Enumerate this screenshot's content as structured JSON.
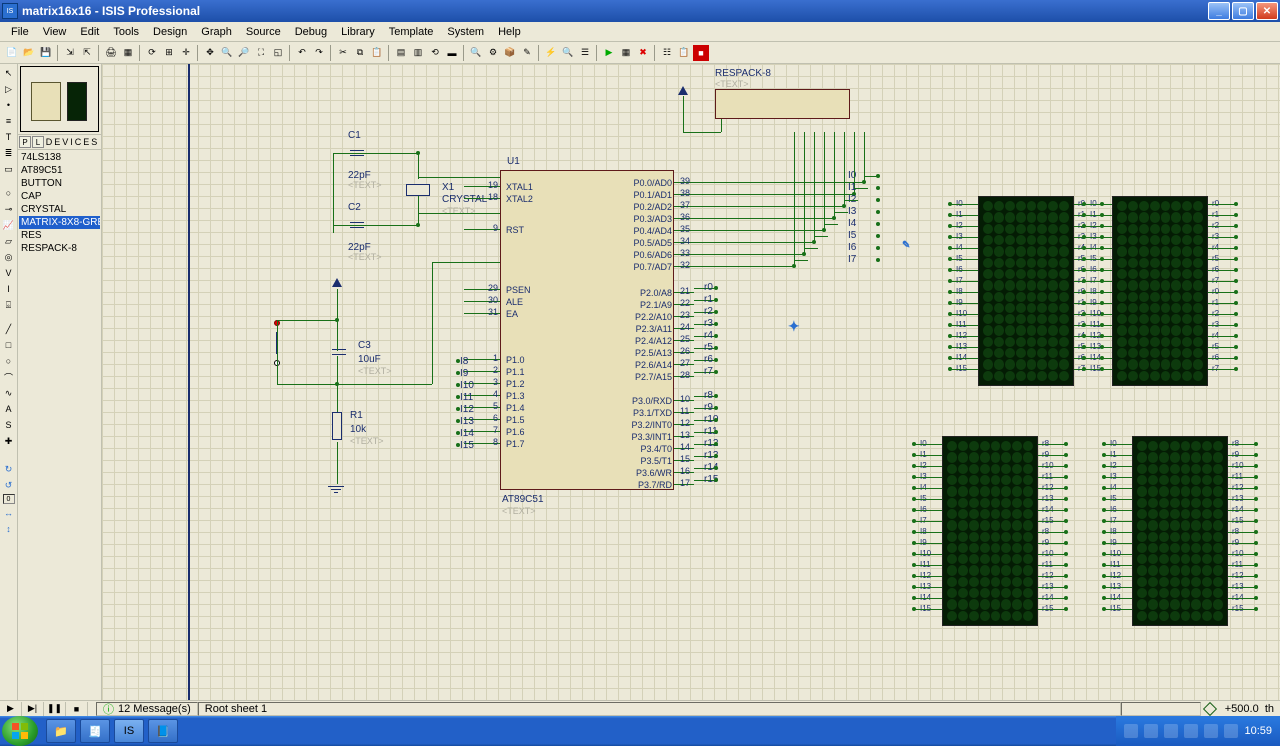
{
  "window": {
    "title": "matrix16x16 - ISIS Professional"
  },
  "menu": [
    "File",
    "View",
    "Edit",
    "Tools",
    "Design",
    "Graph",
    "Source",
    "Debug",
    "Library",
    "Template",
    "System",
    "Help"
  ],
  "devices_panel": {
    "header": "DEVICES",
    "items": [
      "74LS138",
      "AT89C51",
      "BUTTON",
      "CAP",
      "CRYSTAL",
      "MATRIX-8X8-GREEN",
      "RES",
      "RESPACK-8"
    ],
    "selected_index": 5
  },
  "schematic": {
    "mcu": {
      "ref": "U1",
      "part": "AT89C51",
      "text": "<TEXT>",
      "left_pins": [
        {
          "num": "19",
          "name": "XTAL1"
        },
        {
          "num": "18",
          "name": "XTAL2"
        },
        {
          "num": "9",
          "name": "RST"
        },
        {
          "num": "29",
          "name": "PSEN"
        },
        {
          "num": "30",
          "name": "ALE"
        },
        {
          "num": "31",
          "name": "EA"
        },
        {
          "num": "1",
          "name": "P1.0"
        },
        {
          "num": "2",
          "name": "P1.1"
        },
        {
          "num": "3",
          "name": "P1.2"
        },
        {
          "num": "4",
          "name": "P1.3"
        },
        {
          "num": "5",
          "name": "P1.4"
        },
        {
          "num": "6",
          "name": "P1.5"
        },
        {
          "num": "7",
          "name": "P1.6"
        },
        {
          "num": "8",
          "name": "P1.7"
        }
      ],
      "right_pins": [
        {
          "num": "39",
          "name": "P0.0/AD0"
        },
        {
          "num": "38",
          "name": "P0.1/AD1"
        },
        {
          "num": "37",
          "name": "P0.2/AD2"
        },
        {
          "num": "36",
          "name": "P0.3/AD3"
        },
        {
          "num": "35",
          "name": "P0.4/AD4"
        },
        {
          "num": "34",
          "name": "P0.5/AD5"
        },
        {
          "num": "33",
          "name": "P0.6/AD6"
        },
        {
          "num": "32",
          "name": "P0.7/AD7"
        },
        {
          "num": "21",
          "name": "P2.0/A8"
        },
        {
          "num": "22",
          "name": "P2.1/A9"
        },
        {
          "num": "23",
          "name": "P2.2/A10"
        },
        {
          "num": "24",
          "name": "P2.3/A11"
        },
        {
          "num": "25",
          "name": "P2.4/A12"
        },
        {
          "num": "26",
          "name": "P2.5/A13"
        },
        {
          "num": "27",
          "name": "P2.6/A14"
        },
        {
          "num": "28",
          "name": "P2.7/A15"
        },
        {
          "num": "10",
          "name": "P3.0/RXD"
        },
        {
          "num": "11",
          "name": "P3.1/TXD"
        },
        {
          "num": "12",
          "name": "P3.2/INT0"
        },
        {
          "num": "13",
          "name": "P3.3/INT1"
        },
        {
          "num": "14",
          "name": "P3.4/T0"
        },
        {
          "num": "15",
          "name": "P3.5/T1"
        },
        {
          "num": "16",
          "name": "P3.6/WR"
        },
        {
          "num": "17",
          "name": "P3.7/RD"
        }
      ]
    },
    "c1": {
      "ref": "C1",
      "val": "22pF",
      "text": "<TEXT>"
    },
    "c2": {
      "ref": "C2",
      "val": "22pF",
      "text": "<TEXT>"
    },
    "c3": {
      "ref": "C3",
      "val": "10uF",
      "text": "<TEXT>"
    },
    "x1": {
      "ref": "X1",
      "val": "CRYSTAL",
      "text": "<TEXT>"
    },
    "r1": {
      "ref": "R1",
      "val": "10k",
      "text": "<TEXT>"
    },
    "respack": {
      "ref": "RESPACK-8",
      "text": "<TEXT>"
    },
    "bus_labels": {
      "p0_nets": [
        "I0",
        "I1",
        "I2",
        "I3",
        "I4",
        "I5",
        "I6",
        "I7"
      ],
      "p2_nets": [
        "r0",
        "r1",
        "r2",
        "r3",
        "r4",
        "r5",
        "r6",
        "r7"
      ],
      "p3_nets": [
        "r8",
        "r9",
        "r10",
        "r11",
        "r12",
        "r13",
        "r14",
        "r15"
      ],
      "p1_nets": [
        "I8",
        "I9",
        "I10",
        "I11",
        "I12",
        "I13",
        "I14",
        "I15"
      ]
    },
    "matrices": [
      {
        "left": [
          "I0",
          "I1",
          "I2",
          "I3",
          "I4",
          "I5",
          "I6",
          "I7",
          "I8",
          "I9",
          "I10",
          "I11",
          "I12",
          "I13",
          "I14",
          "I15"
        ],
        "right": [
          "r0",
          "r1",
          "r2",
          "r3",
          "r4",
          "r5",
          "r6",
          "r7",
          "r0",
          "r1",
          "r2",
          "r3",
          "r4",
          "r5",
          "r6",
          "r7"
        ]
      },
      {
        "left": [
          "I0",
          "I1",
          "I2",
          "I3",
          "I4",
          "I5",
          "I6",
          "I7",
          "I8",
          "I9",
          "I10",
          "I11",
          "I12",
          "I13",
          "I14",
          "I15"
        ],
        "right": [
          "r0",
          "r1",
          "r2",
          "r3",
          "r4",
          "r5",
          "r6",
          "r7",
          "r0",
          "r1",
          "r2",
          "r3",
          "r4",
          "r5",
          "r6",
          "r7"
        ]
      },
      {
        "left": [
          "I0",
          "I1",
          "I2",
          "I3",
          "I4",
          "I5",
          "I6",
          "I7",
          "I8",
          "I9",
          "I10",
          "I11",
          "I12",
          "I13",
          "I14",
          "I15"
        ],
        "right": [
          "r8",
          "r9",
          "r10",
          "r11",
          "r12",
          "r13",
          "r14",
          "r15",
          "r8",
          "r9",
          "r10",
          "r11",
          "r12",
          "r13",
          "r14",
          "r15"
        ]
      },
      {
        "left": [
          "I0",
          "I1",
          "I2",
          "I3",
          "I4",
          "I5",
          "I6",
          "I7",
          "I8",
          "I9",
          "I10",
          "I11",
          "I12",
          "I13",
          "I14",
          "I15"
        ],
        "right": [
          "r8",
          "r9",
          "r10",
          "r11",
          "r12",
          "r13",
          "r14",
          "r15",
          "r8",
          "r9",
          "r10",
          "r11",
          "r12",
          "r13",
          "r14",
          "r15"
        ]
      }
    ]
  },
  "status": {
    "messages": "12 Message(s)",
    "sheet": "Root sheet 1",
    "coord": "+500.0",
    "unit": "th"
  },
  "taskbar": {
    "time": "10:59"
  }
}
